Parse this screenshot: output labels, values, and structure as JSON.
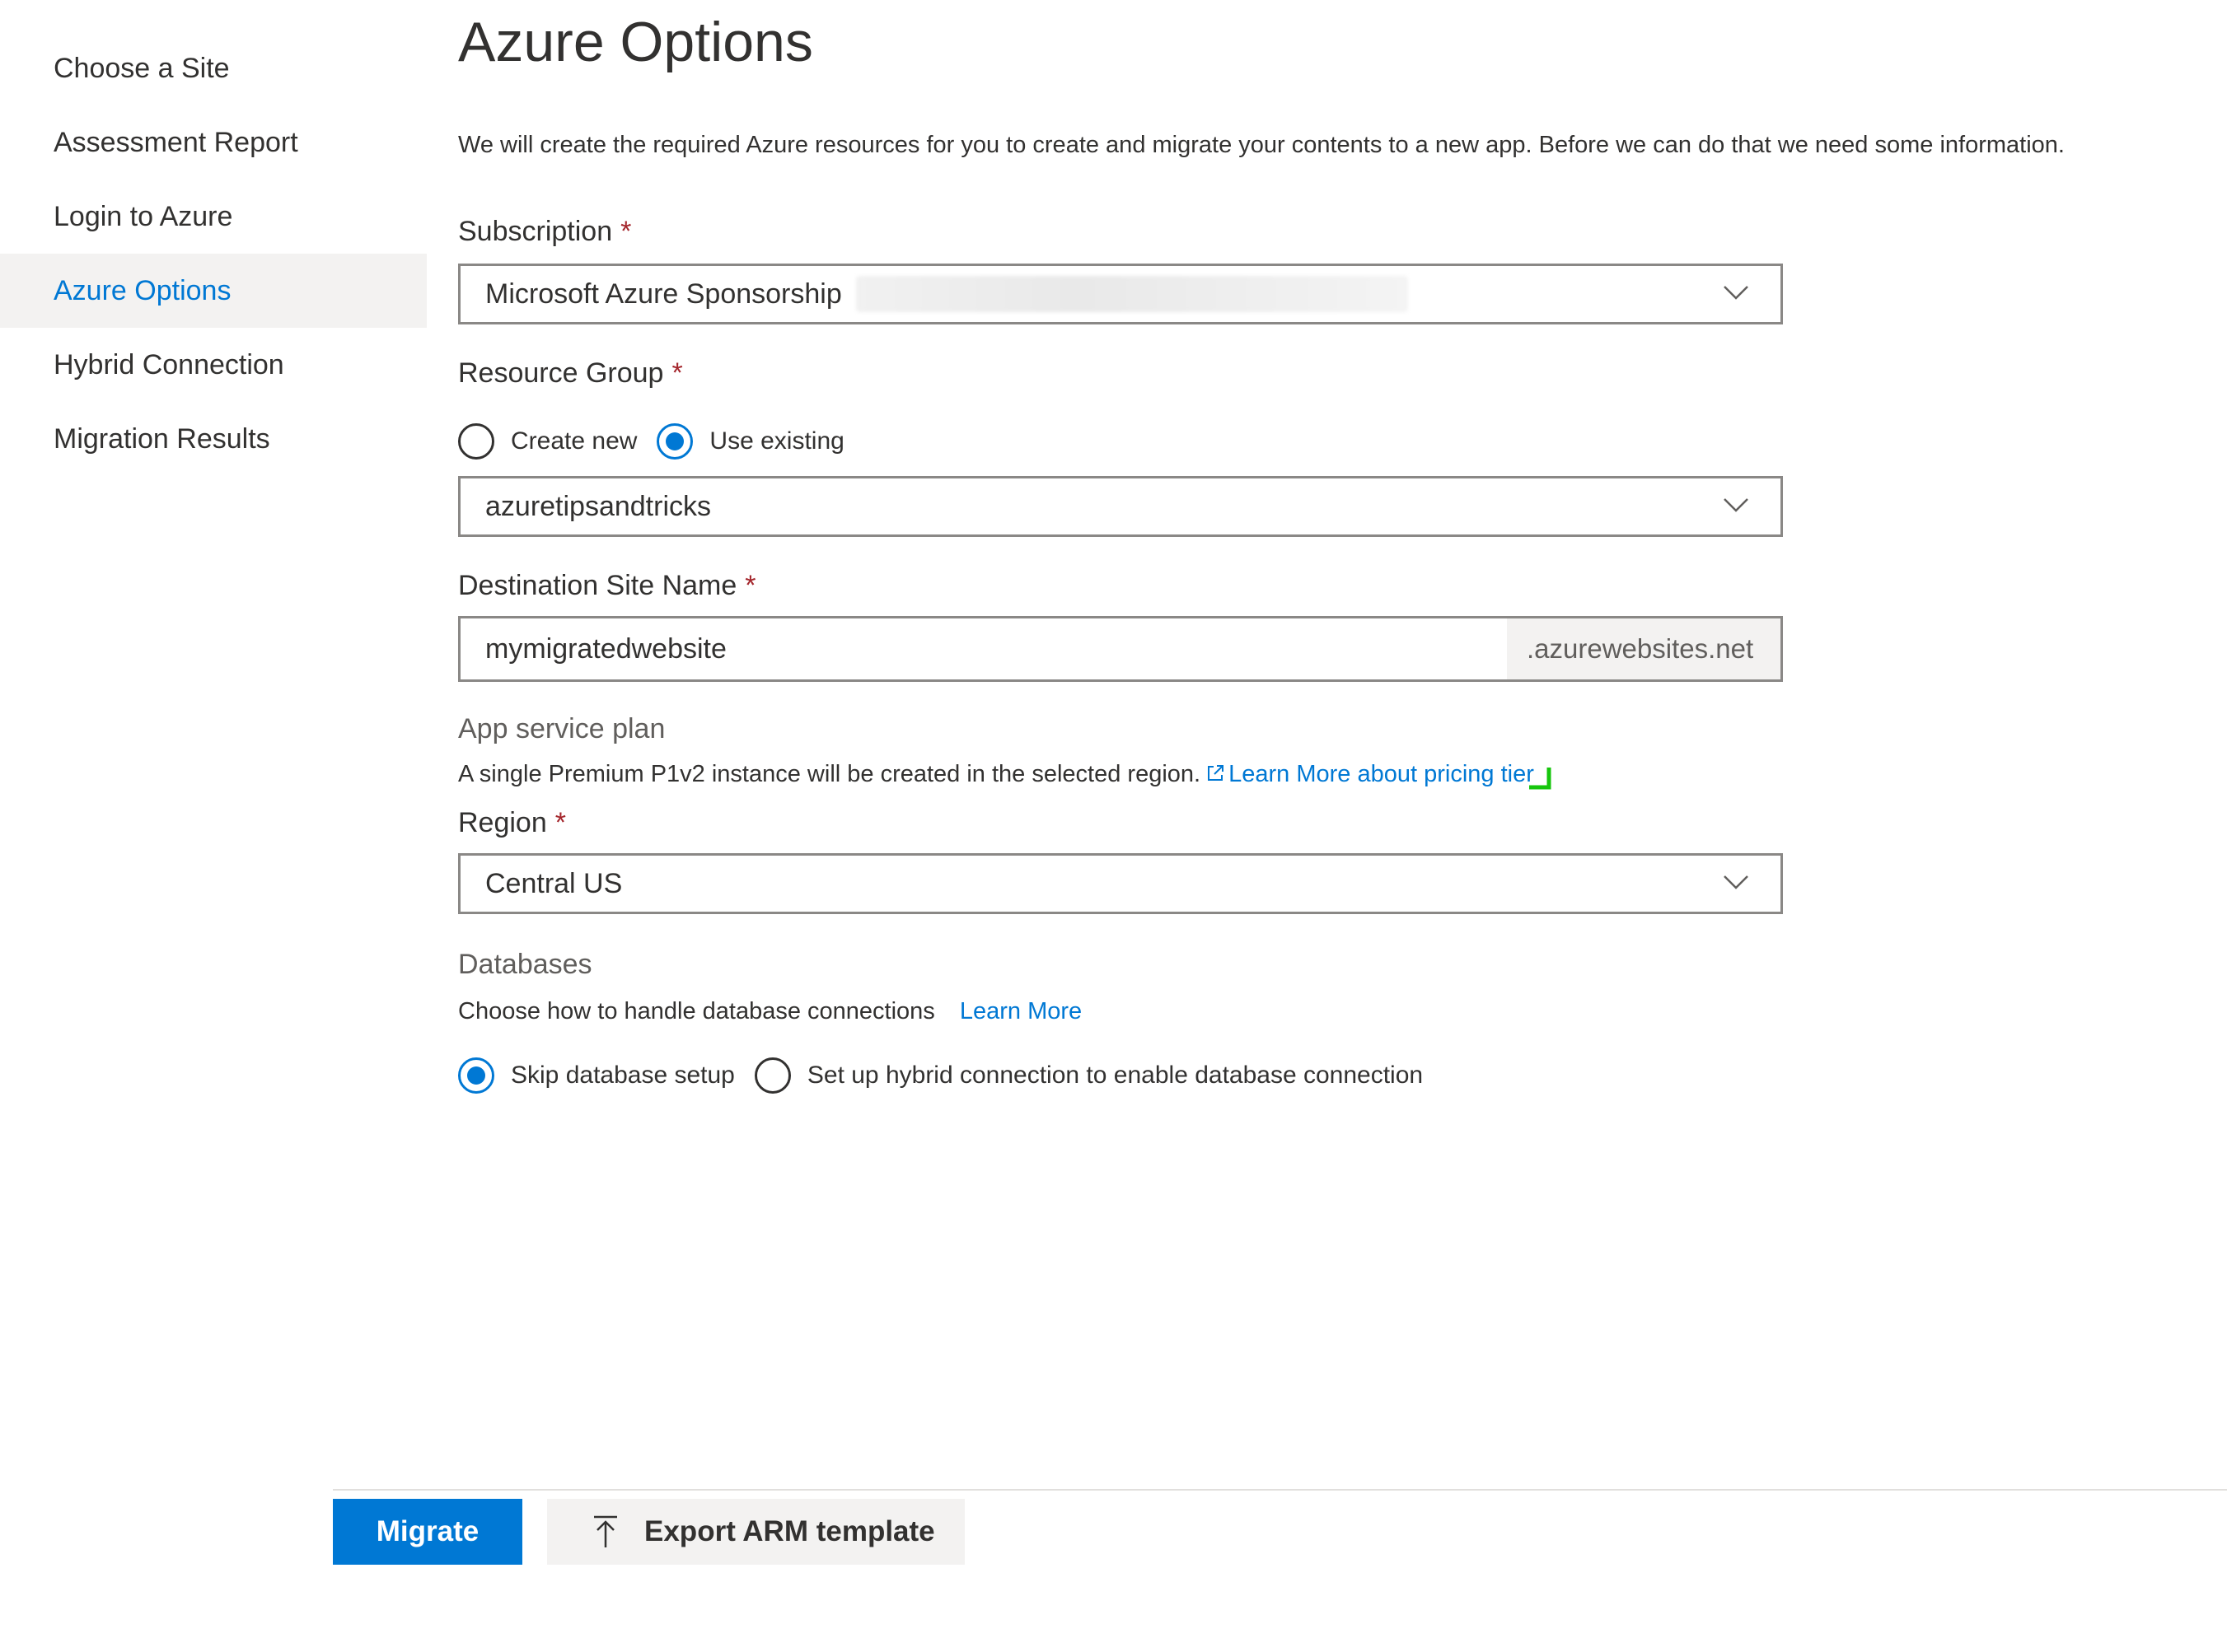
{
  "sidebar": {
    "items": [
      {
        "label": "Choose a Site"
      },
      {
        "label": "Assessment Report"
      },
      {
        "label": "Login to Azure"
      },
      {
        "label": "Azure Options"
      },
      {
        "label": "Hybrid Connection"
      },
      {
        "label": "Migration Results"
      }
    ],
    "active_index": 3
  },
  "page": {
    "title": "Azure Options",
    "intro": "We will create the required Azure resources for you to create and migrate your contents to a new app. Before we can do that we need some information."
  },
  "subscription": {
    "label": "Subscription",
    "required_mark": "*",
    "value": "Microsoft Azure Sponsorship"
  },
  "resource_group": {
    "label": "Resource Group",
    "required_mark": "*",
    "options": [
      "Create new",
      "Use existing"
    ],
    "selected": "Use existing",
    "value": "azuretipsandtricks"
  },
  "destination": {
    "label": "Destination Site Name",
    "required_mark": "*",
    "value": "mymigratedwebsite",
    "suffix": ".azurewebsites.net"
  },
  "app_service_plan": {
    "title": "App service plan",
    "description": "A single Premium P1v2 instance will be created in the selected region.",
    "link_label": "Learn More about pricing tier"
  },
  "region": {
    "label": "Region",
    "required_mark": "*",
    "value": "Central US"
  },
  "databases": {
    "title": "Databases",
    "description": "Choose how to handle database connections",
    "link_label": "Learn More",
    "options": [
      "Skip database setup",
      "Set up hybrid connection to enable database connection"
    ],
    "selected": "Skip database setup"
  },
  "footer": {
    "migrate_label": "Migrate",
    "export_label": "Export ARM template"
  },
  "colors": {
    "accent": "#0078d4",
    "required": "#a4262c",
    "active_nav_bg": "#f3f2f1"
  },
  "icons": [
    "chevron-down-icon",
    "external-link-icon",
    "upload-icon"
  ]
}
